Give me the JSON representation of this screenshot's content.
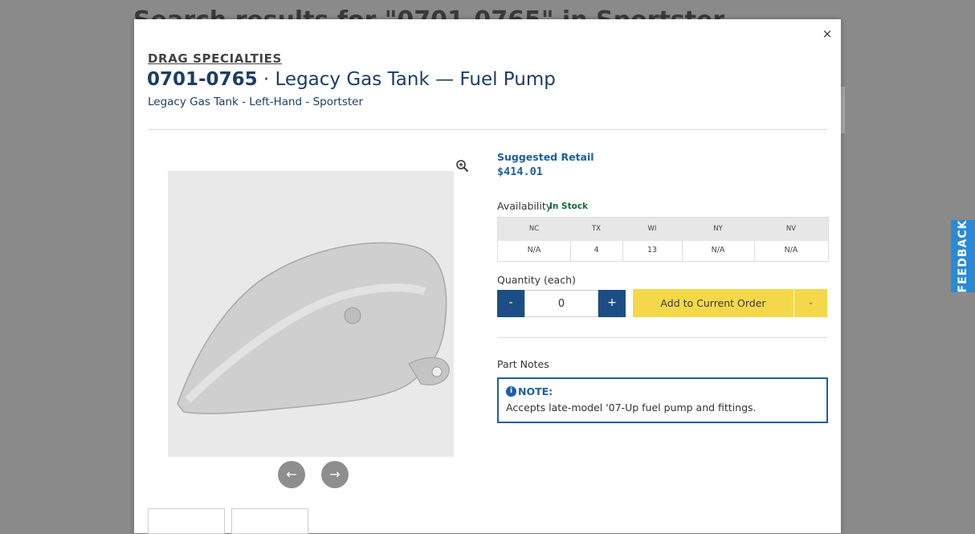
{
  "background": {
    "search_title": "Search results for \"0701-0765\" in Sportster"
  },
  "modal": {
    "close_label": "×",
    "brand": "DRAG SPECIALTIES",
    "part_number": "0701-0765",
    "separator": " · ",
    "name": "Legacy Gas Tank — Fuel Pump",
    "subtitle": "Legacy Gas Tank - Left-Hand - Sportster",
    "gallery": {
      "prev_label": "←",
      "next_label": "→",
      "zoom_icon": "zoom-in-icon"
    },
    "pricing": {
      "label": "Suggested Retail",
      "price": "$414.01"
    },
    "availability": {
      "label": "Availability",
      "status": "In Stock",
      "warehouses": [
        {
          "code": "NC",
          "qty": "N/A"
        },
        {
          "code": "TX",
          "qty": "4"
        },
        {
          "code": "WI",
          "qty": "13"
        },
        {
          "code": "NY",
          "qty": "N/A"
        },
        {
          "code": "NV",
          "qty": "N/A"
        }
      ]
    },
    "quantity": {
      "label": "Quantity (each)",
      "minus": "-",
      "plus": "+",
      "value": "0"
    },
    "order": {
      "add_label": "Add to Current Order",
      "dropdown_icon": "chevron-down-icon"
    },
    "notes": {
      "label": "Part Notes",
      "title": "NOTE:",
      "icon_glyph": "i",
      "text": "Accepts late-model '07-Up fuel pump and fittings."
    }
  },
  "feedback": {
    "label": "FEEDBACK"
  },
  "colors": {
    "primary": "#1c4e85",
    "accent": "#f5d84a",
    "in_stock": "#0b6b38",
    "feedback": "#2a8ad6"
  }
}
